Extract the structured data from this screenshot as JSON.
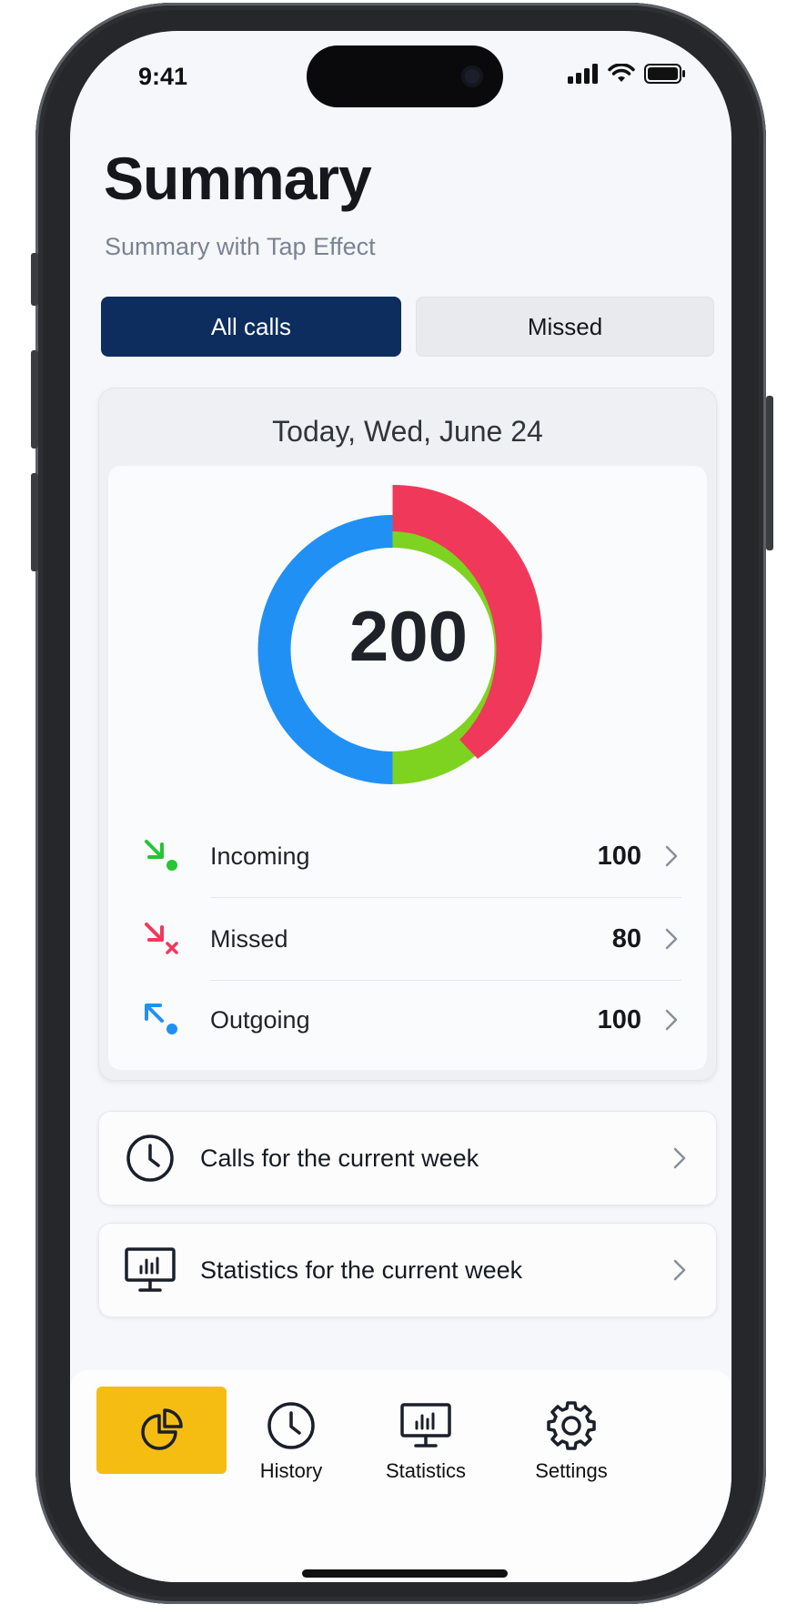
{
  "status_bar": {
    "time": "9:41"
  },
  "header": {
    "title": "Summary",
    "subtitle": "Summary with Tap Effect"
  },
  "segments": [
    {
      "label": "All calls",
      "selected": true
    },
    {
      "label": "Missed",
      "selected": false
    }
  ],
  "summary": {
    "date": "Today, Wed, June 24",
    "total": "200",
    "rows": [
      {
        "label": "Incoming",
        "value": "100",
        "color": "#27c436",
        "icon": "incoming-call-icon"
      },
      {
        "label": "Missed",
        "value": "80",
        "color": "#f0385a",
        "icon": "missed-call-icon"
      },
      {
        "label": "Outgoing",
        "value": "100",
        "color": "#2190f5",
        "icon": "outgoing-call-icon"
      }
    ]
  },
  "links": [
    {
      "label": "Calls for the current week",
      "icon": "clock-icon"
    },
    {
      "label": "Statistics for the current week",
      "icon": "monitor-chart-icon"
    }
  ],
  "tabbar": {
    "items": [
      {
        "label": "",
        "icon": "pie-chart-icon",
        "active": true
      },
      {
        "label": "History",
        "icon": "clock-icon"
      },
      {
        "label": "Statistics",
        "icon": "monitor-chart-icon"
      },
      {
        "label": "Settings",
        "icon": "gear-icon"
      }
    ]
  },
  "colors": {
    "accent_navy": "#0d2d5e",
    "active_tab": "#f5bd12",
    "incoming": "#7ed321",
    "missed": "#f0385a",
    "outgoing": "#2190f5"
  }
}
